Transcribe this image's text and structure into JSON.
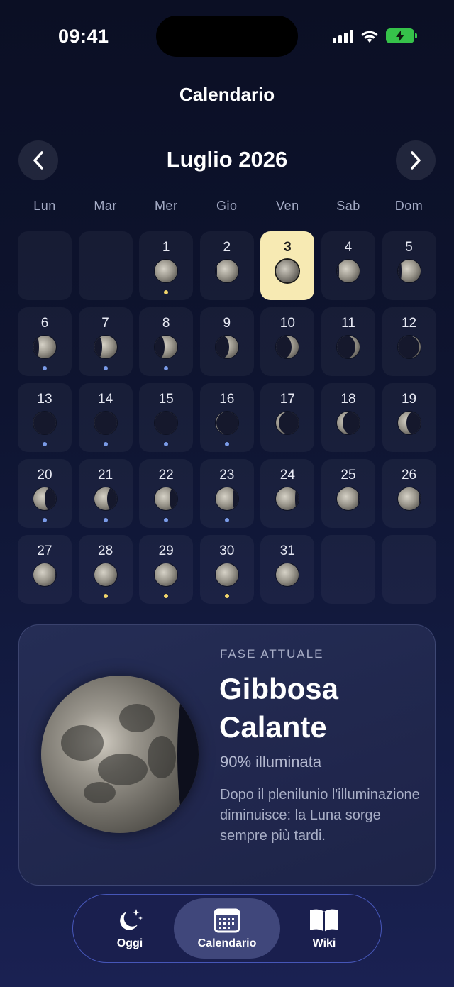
{
  "status": {
    "time": "09:41"
  },
  "header": {
    "title": "Calendario"
  },
  "month": {
    "label": "Luglio 2026"
  },
  "weekdays": [
    "Lun",
    "Mar",
    "Mer",
    "Gio",
    "Ven",
    "Sab",
    "Dom"
  ],
  "days": [
    {
      "n": ""
    },
    {
      "n": ""
    },
    {
      "n": "1",
      "dot": "yellow"
    },
    {
      "n": "2"
    },
    {
      "n": "3",
      "today": true
    },
    {
      "n": "4"
    },
    {
      "n": "5"
    },
    {
      "n": "6",
      "dot": "blue"
    },
    {
      "n": "7",
      "dot": "blue"
    },
    {
      "n": "8",
      "dot": "blue"
    },
    {
      "n": "9"
    },
    {
      "n": "10"
    },
    {
      "n": "11"
    },
    {
      "n": "12"
    },
    {
      "n": "13",
      "dot": "blue"
    },
    {
      "n": "14",
      "dot": "blue"
    },
    {
      "n": "15",
      "dot": "blue"
    },
    {
      "n": "16",
      "dot": "blue"
    },
    {
      "n": "17"
    },
    {
      "n": "18"
    },
    {
      "n": "19"
    },
    {
      "n": "20",
      "dot": "blue"
    },
    {
      "n": "21",
      "dot": "blue"
    },
    {
      "n": "22",
      "dot": "blue"
    },
    {
      "n": "23",
      "dot": "blue"
    },
    {
      "n": "24"
    },
    {
      "n": "25"
    },
    {
      "n": "26"
    },
    {
      "n": "27"
    },
    {
      "n": "28",
      "dot": "yellow"
    },
    {
      "n": "29",
      "dot": "yellow"
    },
    {
      "n": "30",
      "dot": "yellow"
    },
    {
      "n": "31"
    },
    {
      "n": ""
    },
    {
      "n": ""
    }
  ],
  "colors": {
    "today": "#f7eab3",
    "dot_yellow": "#f2d66b",
    "dot_blue": "#7a9be8",
    "accent": "#5a6ee6"
  },
  "phase_card": {
    "label": "FASE ATTUALE",
    "title": "Gibbosa Calante",
    "illumination": "90% illuminata",
    "description": "Dopo il plenilunio l'illuminazione diminuisce: la Luna sorge sempre più tardi."
  },
  "tabs": [
    {
      "label": "Oggi",
      "icon": "moon-stars-icon",
      "active": false
    },
    {
      "label": "Calendario",
      "icon": "calendar-icon",
      "active": true
    },
    {
      "label": "Wiki",
      "icon": "book-icon",
      "active": false
    }
  ]
}
